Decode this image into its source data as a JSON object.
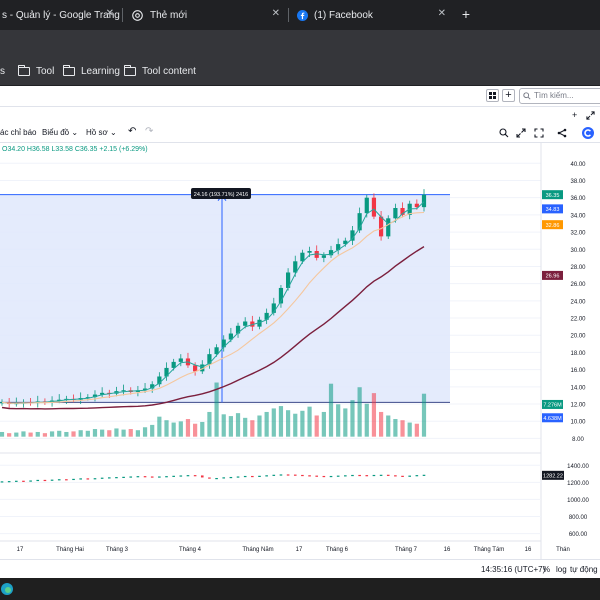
{
  "tabs": [
    {
      "title": "s - Quản lý - Google Trang"
    },
    {
      "title": "Thẻ mới"
    },
    {
      "title": "(1) Facebook"
    }
  ],
  "tab_close": "✕",
  "new_tab": "+",
  "bookmarks": [
    {
      "label": "s"
    },
    {
      "label": "Tool"
    },
    {
      "label": "Learning"
    },
    {
      "label": "Tool content"
    }
  ],
  "site": {
    "search_placeholder": "Tìm kiếm...",
    "plus": "+"
  },
  "chart_toolbar": {
    "indicators": "ác chỉ báo",
    "charts": "Biểu đồ",
    "profile": "Hồ sơ",
    "undo": "↶",
    "redo": "↷"
  },
  "ohlc": {
    "open": "O34.20",
    "high": "H36.58",
    "low": "L33.58",
    "close": "C36.35",
    "change": "+2.15 (+6.29%)"
  },
  "measure_label": "24.16 (193.71%) 2416",
  "status": {
    "time": "14:35:16 (UTC+7)",
    "percent": "%",
    "log": "log",
    "auto": "tự động"
  },
  "colors": {
    "up": "#089981",
    "down": "#f23645",
    "ma_fast": "#26a69a",
    "ma_mid": "#f5c79e",
    "ma_slow": "#7b1f3d",
    "range_fill": "#dfe8fb",
    "range_line": "#2962ff"
  },
  "chart_data": [
    {
      "type": "candlestick",
      "title": "",
      "x_ticks": [
        "17",
        "Tháng Hai",
        "Tháng 3",
        "Tháng 4",
        "Tháng Năm",
        "17",
        "Tháng 6",
        "Tháng 7",
        "16",
        "Tháng Tám",
        "16",
        "Thán"
      ],
      "y_ticks": [
        "40.00",
        "38.00",
        "36.00",
        "34.00",
        "32.00",
        "30.00",
        "28.00",
        "26.00",
        "24.00",
        "22.00",
        "20.00",
        "18.00",
        "16.00",
        "14.00",
        "12.00",
        "10.00",
        "8.00"
      ],
      "ylim": [
        7,
        40.5
      ],
      "price_labels": [
        {
          "text": "36.35",
          "value": 36.35,
          "color": "#089981"
        },
        {
          "text": "34.83",
          "value": 34.7,
          "color": "#2962ff"
        },
        {
          "text": "32.86",
          "value": 32.86,
          "color": "#ff9800"
        },
        {
          "text": "26.96",
          "value": 26.96,
          "color": "#7b1f3d"
        },
        {
          "text": "7.276M",
          "value": 11.95,
          "color": "#089981"
        },
        {
          "text": "4.638M",
          "value": 10.4,
          "color": "#2962ff"
        }
      ],
      "measure_range": [
        12.19,
        36.35
      ],
      "close_series": [
        12.2,
        12.0,
        12.1,
        12.2,
        12.1,
        12.3,
        12.2,
        12.4,
        12.5,
        12.6,
        12.5,
        12.7,
        12.8,
        13.1,
        13.3,
        13.2,
        13.5,
        13.6,
        13.4,
        13.6,
        13.8,
        14.3,
        15.2,
        16.2,
        16.9,
        17.3,
        16.5,
        15.8,
        16.6,
        17.8,
        18.6,
        19.5,
        20.2,
        21.1,
        21.6,
        21.0,
        21.8,
        22.6,
        23.7,
        25.5,
        27.3,
        28.6,
        29.6,
        29.8,
        29.0,
        29.3,
        29.9,
        30.6,
        31.0,
        32.2,
        34.2,
        36.0,
        33.8,
        31.5,
        33.6,
        34.8,
        34.0,
        35.3,
        34.9,
        36.35
      ],
      "volume_series": [
        0.8,
        0.6,
        0.7,
        0.9,
        0.7,
        0.8,
        0.6,
        0.9,
        1.0,
        0.8,
        0.9,
        1.1,
        1.0,
        1.3,
        1.2,
        1.1,
        1.4,
        1.2,
        1.3,
        1.1,
        1.6,
        2.0,
        3.4,
        2.8,
        2.4,
        2.6,
        3.0,
        2.2,
        2.5,
        4.2,
        9.2,
        3.8,
        3.5,
        4.0,
        3.2,
        2.8,
        3.6,
        4.2,
        4.8,
        5.2,
        4.5,
        3.9,
        4.4,
        5.1,
        3.6,
        4.2,
        9.0,
        5.5,
        4.8,
        6.2,
        8.4,
        5.6,
        7.4,
        4.2,
        3.6,
        3.0,
        2.8,
        2.4,
        2.2,
        7.3
      ]
    },
    {
      "type": "line",
      "title": "",
      "y_ticks": [
        "1400.00",
        "1200.00",
        "1000.00",
        "800.00",
        "600.00"
      ],
      "ylim": [
        560,
        1450
      ],
      "price_labels": [
        {
          "text": "1282.22",
          "value": 1282.22,
          "color": "#131722"
        }
      ],
      "values": [
        1205,
        1208,
        1212,
        1207,
        1215,
        1222,
        1218,
        1225,
        1230,
        1228,
        1234,
        1240,
        1236,
        1242,
        1248,
        1252,
        1255,
        1258,
        1262,
        1266,
        1262,
        1258,
        1262,
        1266,
        1270,
        1274,
        1278,
        1274,
        1250,
        1236,
        1244,
        1252,
        1256,
        1262,
        1268,
        1266,
        1270,
        1276,
        1282,
        1286,
        1284,
        1280,
        1276,
        1272,
        1268,
        1264,
        1268,
        1272,
        1276,
        1280,
        1278,
        1276,
        1280,
        1282,
        1276,
        1270,
        1266,
        1272,
        1278,
        1282
      ]
    }
  ]
}
